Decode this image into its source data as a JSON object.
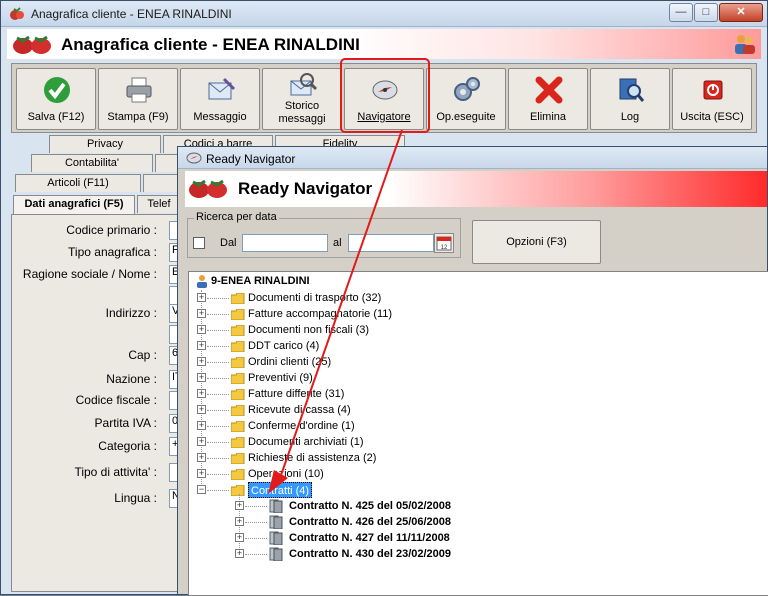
{
  "main_window": {
    "title": "Anagrafica cliente - ENEA RINALDINI",
    "header_title": "Anagrafica cliente - ENEA RINALDINI",
    "min_label": "—",
    "max_label": "□",
    "close_label": "✕"
  },
  "toolbar": [
    {
      "label": "Salva (F12)",
      "icon": "check-icon"
    },
    {
      "label": "Stampa (F9)",
      "icon": "printer-icon"
    },
    {
      "label": "Messaggio",
      "icon": "envelope-icon"
    },
    {
      "label": "Storico messaggi",
      "line1": "Storico",
      "line2": "messaggi",
      "icon": "message-history-icon"
    },
    {
      "label": "Navigatore",
      "icon": "compass-icon"
    },
    {
      "label": "Op.eseguite",
      "icon": "gears-icon"
    },
    {
      "label": "Elimina",
      "icon": "delete-x-icon"
    },
    {
      "label": "Log",
      "icon": "log-magnifier-icon"
    },
    {
      "label": "Uscita (ESC)",
      "icon": "exit-icon"
    }
  ],
  "tabs": {
    "privacy": "Privacy",
    "codici": "Codici a barre",
    "fidelity": "Fidelity",
    "contabilita": "Contabilita'",
    "articoli": "Articoli (F11)",
    "dati": "Dati anagrafici (F5)",
    "telefono": "Telef"
  },
  "form_labels": {
    "codice_primario": "Codice primario :",
    "tipo_anagrafica": "Tipo anagrafica :",
    "ragione_sociale": "Ragione sociale / Nome :",
    "indirizzo": "Indirizzo :",
    "cap": "Cap :",
    "nazione": "Nazione :",
    "codice_fiscale": "Codice fiscale :",
    "partita_iva": "Partita IVA :",
    "categoria": "Categoria :",
    "tipo_attivita": "Tipo di attivita' :",
    "lingua": "Lingua :"
  },
  "form_values": {
    "tipo": "F",
    "ragione": "E",
    "indirizzo": "V",
    "cap": "6",
    "nazione": "IT",
    "partita": "0",
    "categoria": "+",
    "lingua": "N"
  },
  "navigator": {
    "title": "Ready Navigator",
    "header_title": "Ready Navigator",
    "group_label": "Ricerca per data",
    "dal_label": "Dal",
    "al_label": "al",
    "options_button": "Opzioni (F3)",
    "root": "9-ENEA RINALDINI",
    "items": [
      "Documenti di trasporto (32)",
      "Fatture accompagnatorie (11)",
      "Documenti non fiscali (3)",
      "DDT carico (4)",
      "Ordini clienti (25)",
      "Preventivi (9)",
      "Fatture differite (31)",
      "Ricevute di cassa (4)",
      "Conferme d'ordine (1)",
      "Documenti archiviati (1)",
      "Richieste di assistenza (2)",
      "Operazioni (10)",
      "Contratti (4)"
    ],
    "contracts": [
      "Contratto N. 425 del 05/02/2008",
      "Contratto N. 426 del 25/06/2008",
      "Contratto N. 427 del 11/11/2008",
      "Contratto N. 430 del 23/02/2009"
    ]
  },
  "colors": {
    "highlight_red": "#e21a1a",
    "selection_blue": "#3399ff"
  }
}
